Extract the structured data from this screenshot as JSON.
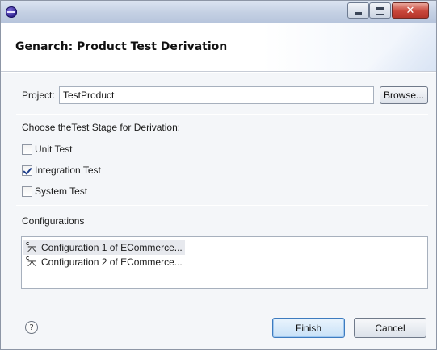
{
  "window": {
    "title": ""
  },
  "banner": {
    "title": "Genarch: Product Test Derivation"
  },
  "project": {
    "label": "Project:",
    "value": "TestProduct",
    "browse_label": "Browse..."
  },
  "stage": {
    "heading": "Choose theTest  Stage for Derivation:",
    "options": [
      {
        "label": "Unit Test",
        "checked": false
      },
      {
        "label": "Integration Test",
        "checked": true
      },
      {
        "label": "System Test",
        "checked": false
      }
    ]
  },
  "configurations": {
    "heading": "Configurations",
    "items": [
      {
        "label": "Configuration 1 of ECommerce...",
        "selected": true,
        "icon": "configuration-icon"
      },
      {
        "label": "Configuration 2 of ECommerce...",
        "selected": false,
        "icon": "configuration-icon"
      }
    ]
  },
  "footer": {
    "help_icon": "?",
    "finish_label": "Finish",
    "cancel_label": "Cancel"
  },
  "colors": {
    "titlebar": "#c4d0e3",
    "close_button": "#c8463a",
    "body_bg": "#f4f6f9",
    "default_button_border": "#3d7bbf"
  }
}
